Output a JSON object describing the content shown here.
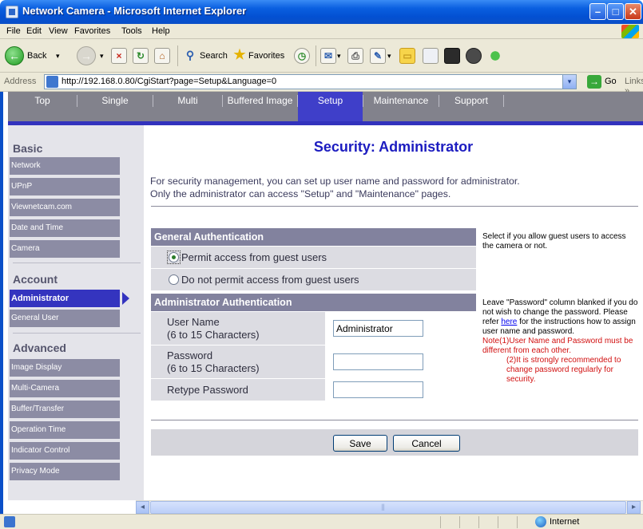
{
  "window": {
    "title": "Network Camera - Microsoft Internet Explorer",
    "min_glyph": "–",
    "max_glyph": "□",
    "close_glyph": "✕"
  },
  "menu": [
    "File",
    "Edit",
    "View",
    "Favorites",
    "Tools",
    "Help"
  ],
  "toolbar": {
    "back_label": "Back",
    "search_label": "Search",
    "favorites_label": "Favorites",
    "back_glyph": "←",
    "forward_glyph": "→",
    "stop_glyph": "×",
    "refresh_glyph": "↻",
    "home_glyph": "⌂",
    "search_glyph": "⚲",
    "favorites_glyph": "★",
    "history_glyph": "◷",
    "mail_glyph": "✉",
    "print_glyph": "⎙",
    "edit_glyph": "✎",
    "dropdown_glyph": "▾",
    "folder_glyph": "▭",
    "icons": [
      "back-arrow-icon",
      "forward-arrow-icon",
      "stop-icon",
      "refresh-icon",
      "home-icon",
      "search-icon",
      "favorites-star-icon",
      "history-icon",
      "mail-icon",
      "print-icon",
      "edit-icon",
      "folder-icon",
      "research-icon",
      "messenger-icon",
      "media-icon",
      "users-icon"
    ]
  },
  "address": {
    "label": "Address",
    "url": "http://192.168.0.80/CgiStart?page=Setup&Language=0",
    "dropdown_glyph": "▾",
    "go_glyph": "→",
    "go_label": "Go",
    "links_label": "Links »"
  },
  "tabs": [
    {
      "label": "Top"
    },
    {
      "label": "Single"
    },
    {
      "label": "Multi"
    },
    {
      "label": "Buffered Image"
    },
    {
      "label": "Setup",
      "active": true
    },
    {
      "label": "Maintenance"
    },
    {
      "label": "Support"
    }
  ],
  "sidebar": {
    "basic_heading": "Basic",
    "basic_items": [
      "Network",
      "UPnP",
      "Viewnetcam.com",
      "Date and Time",
      "Camera"
    ],
    "account_heading": "Account",
    "account_items": [
      "Administrator",
      "General User"
    ],
    "advanced_heading": "Advanced",
    "advanced_items": [
      "Image Display",
      "Multi-Camera",
      "Buffer/Transfer",
      "Operation Time",
      "Indicator Control",
      "Privacy Mode"
    ],
    "active_item": "Administrator"
  },
  "page": {
    "title": "Security: Administrator",
    "intro_line1": "For security management, you can set up user name and password for administrator.",
    "intro_line2": "Only the administrator can access \"Setup\" and \"Maintenance\" pages."
  },
  "general_auth": {
    "heading": "General Authentication",
    "option_permit": "Permit access from guest users",
    "option_deny": "Do not permit access from guest users",
    "selected": "permit",
    "help": "Select if you allow guest users to access the camera or not."
  },
  "admin_auth": {
    "heading": "Administrator Authentication",
    "user_name_label": "User Name",
    "user_name_hint": "(6 to 15 Characters)",
    "user_name_value": "Administrator",
    "password_label": "Password",
    "password_hint": "(6 to 15 Characters)",
    "password_value": "",
    "retype_label": "Retype Password",
    "retype_value": "",
    "help_before_link": "Leave \"Password\" column blanked if you do not wish to change the password. Please refer",
    "help_link": "here",
    "help_after_link": "for the instructions how to assign user name and password.",
    "note1_prefix": "Note(1)",
    "note1_text": "User Name and Password must be different from each other.",
    "note2_prefix": "(2)",
    "note2_text": "It is strongly recommended to change password regularly for security."
  },
  "buttons": {
    "save": "Save",
    "cancel": "Cancel"
  },
  "scrollbar": {
    "left_glyph": "◂",
    "right_glyph": "▸"
  },
  "status": {
    "zone": "Internet"
  },
  "colors": {
    "accent": "#3434bf",
    "title_blue": "#1c1cc0",
    "sidebar_item": "#8c8ca4",
    "section_header": "#82829e",
    "note_red": "#d11010"
  }
}
